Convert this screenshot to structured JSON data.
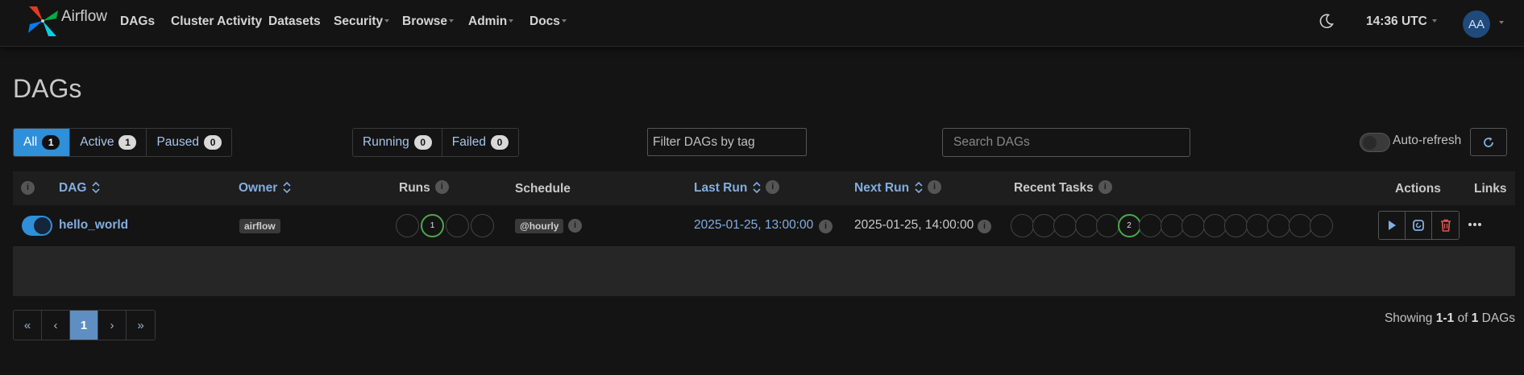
{
  "navbar": {
    "brand": "Airflow",
    "items": [
      {
        "label": "DAGs",
        "dropdown": false
      },
      {
        "label": "Cluster Activity",
        "dropdown": false
      },
      {
        "label": "Datasets",
        "dropdown": false
      },
      {
        "label": "Security",
        "dropdown": true
      },
      {
        "label": "Browse",
        "dropdown": true
      },
      {
        "label": "Admin",
        "dropdown": true
      },
      {
        "label": "Docs",
        "dropdown": true
      }
    ],
    "time": "14:36 UTC",
    "user_initials": "AA"
  },
  "page_title": "DAGs",
  "filters": {
    "status": [
      {
        "label": "All",
        "count": "1",
        "active": true
      },
      {
        "label": "Active",
        "count": "1",
        "active": false
      },
      {
        "label": "Paused",
        "count": "0",
        "active": false
      }
    ],
    "run_state": [
      {
        "label": "Running",
        "count": "0"
      },
      {
        "label": "Failed",
        "count": "0"
      }
    ],
    "tag_placeholder": "Filter DAGs by tag",
    "search_placeholder": "Search DAGs",
    "autorefresh_label": "Auto-refresh"
  },
  "table": {
    "headers": {
      "dag": "DAG",
      "owner": "Owner",
      "runs": "Runs",
      "schedule": "Schedule",
      "last_run": "Last Run",
      "next_run": "Next Run",
      "recent_tasks": "Recent Tasks",
      "actions": "Actions",
      "links": "Links"
    },
    "rows": [
      {
        "enabled": true,
        "dag_id": "hello_world",
        "owner": "airflow",
        "runs": [
          "",
          "1",
          "",
          ""
        ],
        "schedule": "@hourly",
        "last_run": "2025-01-25, 13:00:00",
        "next_run": "2025-01-25, 14:00:00",
        "recent_tasks": [
          "",
          "",
          "",
          "",
          "",
          "2",
          "",
          "",
          "",
          "",
          "",
          "",
          "",
          "",
          ""
        ]
      }
    ]
  },
  "pagination": {
    "first": "«",
    "prev": "‹",
    "current": "1",
    "next": "›",
    "last": "»"
  },
  "showing": {
    "prefix": "Showing",
    "range": "1-1",
    "of": "of",
    "total": "1",
    "suffix": "DAGs"
  },
  "colors": {
    "accent": "#2f8fd8",
    "link": "#82aee0",
    "success": "#4aa84a",
    "delete": "#e05555"
  },
  "icons": {
    "logo": "airflow-pinwheel-logo",
    "theme": "moon-icon",
    "refresh": "refresh-icon",
    "info": "info-icon",
    "sort": "sort-icon",
    "trigger": "play-icon",
    "clear": "clear-icon",
    "delete": "trash-icon",
    "links": "ellipsis-icon"
  }
}
